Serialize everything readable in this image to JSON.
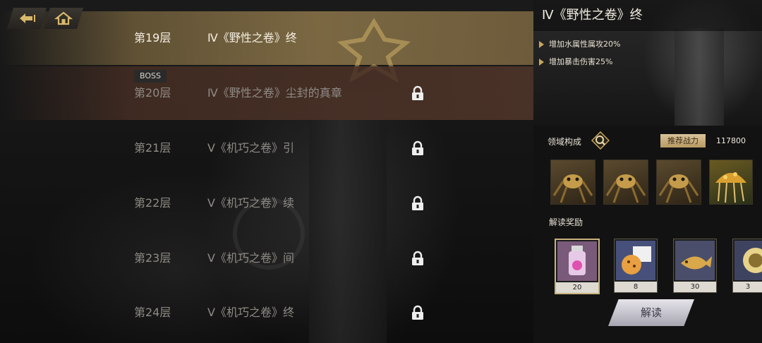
{
  "nav": {
    "back_icon": "back-arrow-icon",
    "home_icon": "home-icon"
  },
  "floors": [
    {
      "num": "第19层",
      "title": "Ⅳ《野性之卷》终",
      "locked": false,
      "selected": true
    },
    {
      "num": "第20层",
      "title": "Ⅳ《野性之卷》尘封的真章",
      "locked": true,
      "boss": true
    },
    {
      "num": "第21层",
      "title": "Ⅴ《机巧之卷》引",
      "locked": true
    },
    {
      "num": "第22层",
      "title": "Ⅴ《机巧之卷》续",
      "locked": true
    },
    {
      "num": "第23层",
      "title": "Ⅴ《机巧之卷》间",
      "locked": true
    },
    {
      "num": "第24层",
      "title": "Ⅴ《机巧之卷》终",
      "locked": true
    }
  ],
  "boss_tag": "BOSS",
  "detail": {
    "title": "Ⅳ《野性之卷》终",
    "buffs": [
      "增加水属性属攻20%",
      "增加暴击伤害25%"
    ],
    "domain_label": "领域构成",
    "power_label": "推荐战力",
    "power_value": "117800",
    "enemies": [
      "mantis-enemy",
      "mantis-enemy",
      "mantis-enemy",
      "jellyfish-enemy"
    ],
    "reward_label": "解读奖励",
    "rewards": [
      {
        "icon": "potion-jar-icon",
        "count": "20"
      },
      {
        "icon": "sandwich-snack-icon",
        "count": "8"
      },
      {
        "icon": "golden-fish-icon",
        "count": "30"
      },
      {
        "icon": "orb-icon",
        "count": "3"
      }
    ],
    "decode_button": "解读"
  },
  "colors": {
    "accent_gold": "#c9a75a",
    "selected_row": "#8c764a",
    "boss_row": "#4e3428"
  }
}
